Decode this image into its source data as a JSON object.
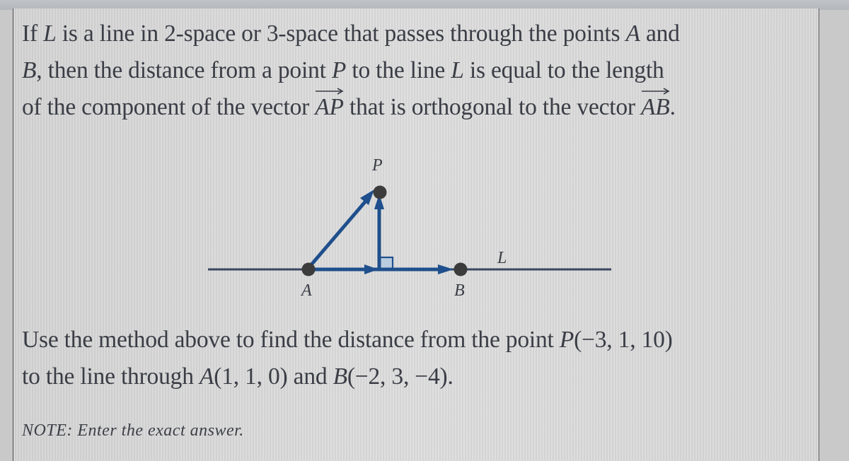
{
  "intro": {
    "line1": {
      "t1": "If ",
      "L": "L",
      "t2": " is a line in 2-space or 3-space that passes through the points ",
      "A": "A",
      "t3": " and"
    },
    "line2": {
      "B": "B",
      "t1": ", then the distance from a point ",
      "P": "P",
      "t2": " to the line ",
      "L": "L",
      "t3": " is equal to the length"
    },
    "line3": {
      "t1": "of the component of the vector ",
      "vec1": "AP",
      "t2": " that is orthogonal to the vector ",
      "vec2": "AB",
      "t3": "."
    }
  },
  "diagram": {
    "labels": {
      "P": "P",
      "A": "A",
      "B": "B",
      "L": "L"
    },
    "colors": {
      "vector": "#1f4f8c",
      "line": "#3a4660",
      "point": "#3c3c3c",
      "right_angle_fill": "#b9cde0"
    }
  },
  "problem": {
    "line1": {
      "t1": "Use the method above to find the distance from the point ",
      "P": "P",
      "coords": "(−3, 1, 10)"
    },
    "line2": {
      "t1": "to the line through ",
      "A": "A",
      "a_coords": "(1, 1, 0)",
      "t2": " and ",
      "B": "B",
      "b_coords": "(−2, 3, −4)",
      "t3": "."
    }
  },
  "note": "NOTE: Enter the exact answer."
}
